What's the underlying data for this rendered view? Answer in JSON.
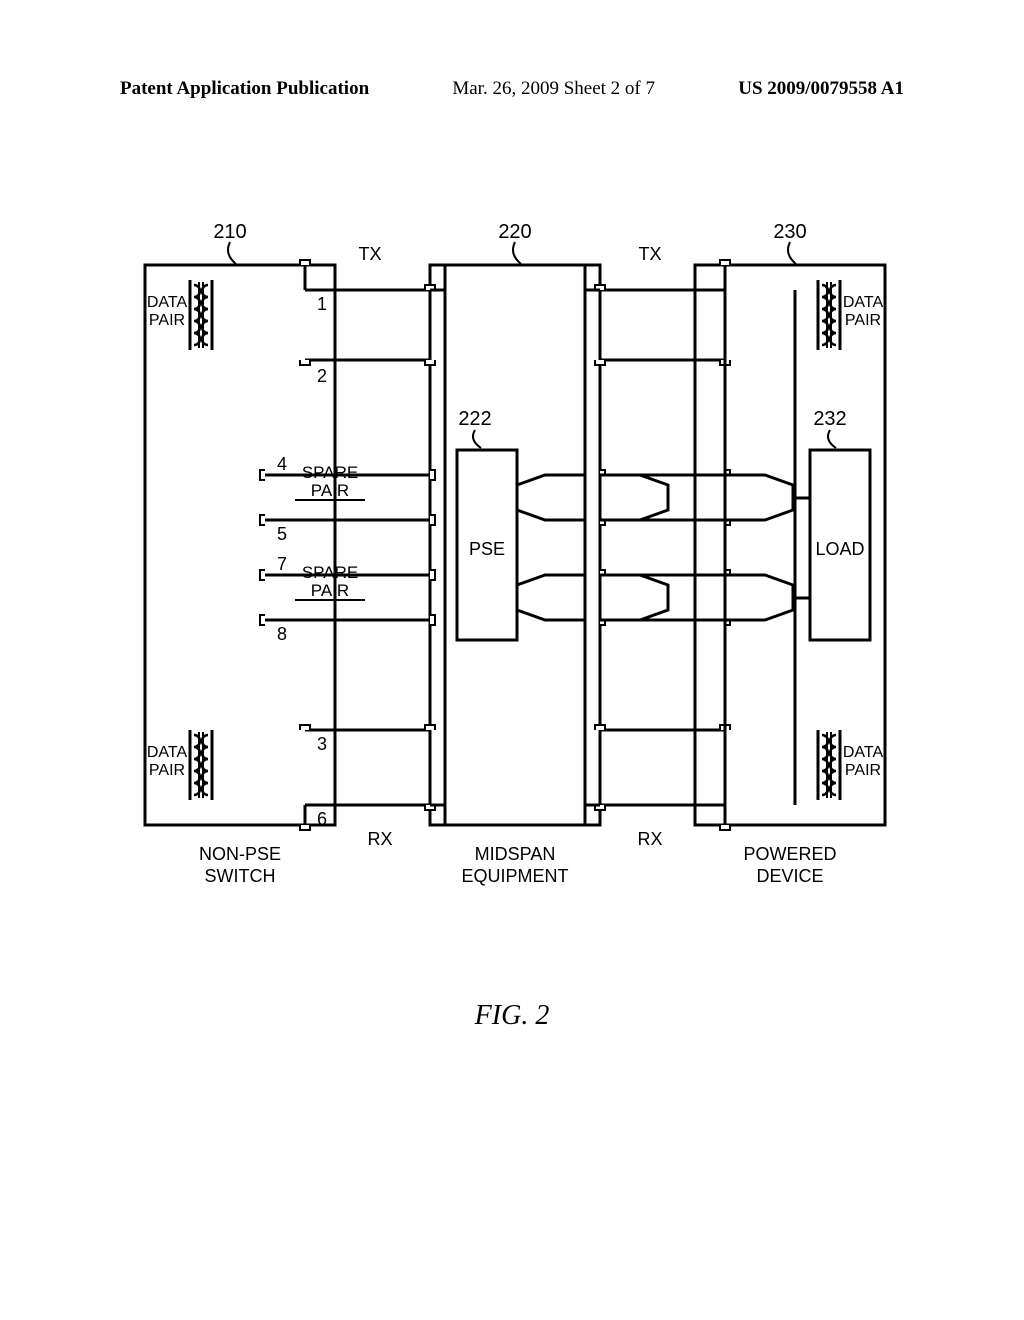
{
  "header": {
    "left": "Patent Application Publication",
    "mid": "Mar. 26, 2009  Sheet 2 of 7",
    "right": "US 2009/0079558 A1"
  },
  "caption": "FIG. 2",
  "refs": {
    "r210": "210",
    "r220": "220",
    "r230": "230",
    "r222": "222",
    "r232": "232"
  },
  "labels": {
    "tx": "TX",
    "rx": "RX",
    "data": "DATA",
    "pair": "PAIR",
    "spare": "SPARE",
    "pse": "PSE",
    "load": "LOAD",
    "nonpse1": "NON-PSE",
    "nonpse2": "SWITCH",
    "midspan1": "MIDSPAN",
    "midspan2": "EQUIPMENT",
    "pd1": "POWERED",
    "pd2": "DEVICE"
  },
  "pins": {
    "p1": "1",
    "p2": "2",
    "p3": "3",
    "p4": "4",
    "p5": "5",
    "p6": "6",
    "p7": "7",
    "p8": "8"
  }
}
